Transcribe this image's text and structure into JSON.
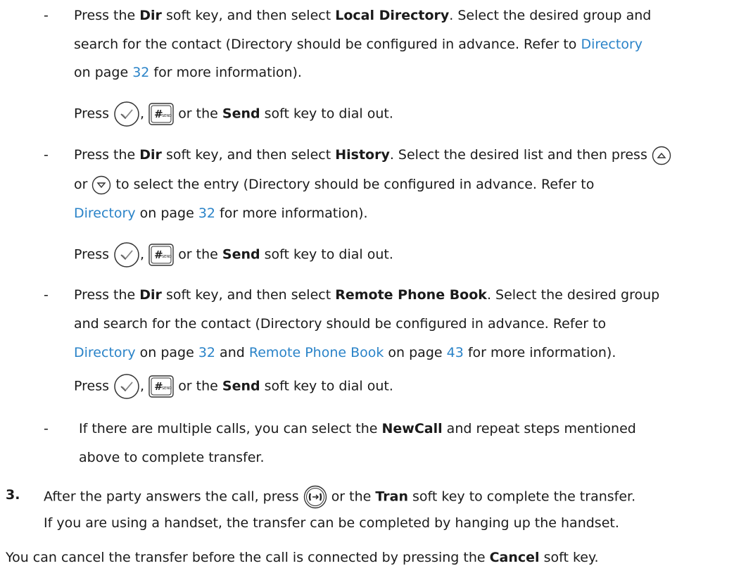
{
  "bullet1": {
    "dash": "-",
    "l1_a": "Press the ",
    "l1_dir": "Dir",
    "l1_b": " soft key, and then select ",
    "l1_target": "Local Directory",
    "l1_c": ". Select the desired group and",
    "l2_a": "search for the contact (Directory should be configured in advance. Refer to ",
    "l2_link": "Directory",
    "l3_a": "on page ",
    "l3_page": "32",
    "l3_b": " for more information).",
    "press": "Press ",
    "comma": ", ",
    "press_tail_a": " or the ",
    "send": "Send",
    "press_tail_b": " soft key to dial out."
  },
  "bullet2": {
    "dash": "-",
    "l1_a": "Press the ",
    "l1_dir": "Dir",
    "l1_b": " soft key, and then select ",
    "l1_target": "History",
    "l1_c": ". Select the desired list and then press ",
    "l2_a": "or ",
    "l2_b": " to select the entry (Directory should be configured in advance. Refer to",
    "l3_link": "Directory",
    "l3_a": " on page ",
    "l3_page": "32",
    "l3_b": " for more information).",
    "press": "Press ",
    "comma": ", ",
    "press_tail_a": " or the ",
    "send": "Send",
    "press_tail_b": " soft key to dial out."
  },
  "bullet3": {
    "dash": "-",
    "l1_a": "Press the ",
    "l1_dir": "Dir",
    "l1_b": " soft key, and then select ",
    "l1_target": "Remote Phone Book",
    "l1_c": ". Select the desired group",
    "l2_a": "and search for the contact (Directory should be configured in advance. Refer to",
    "l3_link1": "Directory",
    "l3_a": " on page ",
    "l3_page1": "32",
    "l3_b": " and ",
    "l3_link2": "Remote Phone Book",
    "l3_c": " on page ",
    "l3_page2": "43",
    "l3_d": " for more information).",
    "press": "Press ",
    "comma": ", ",
    "press_tail_a": " or the ",
    "send": "Send",
    "press_tail_b": " soft key to dial out."
  },
  "bullet4": {
    "dash": "-",
    "l1_a": "If there are multiple calls, you can select the ",
    "l1_b": "NewCall",
    "l1_c": " and repeat steps mentioned",
    "l2": "above to complete transfer."
  },
  "step3": {
    "num": "3.",
    "l1_a": "After the party answers the call, press ",
    "l1_b": " or the ",
    "l1_tran": "Tran",
    "l1_c": " soft key to complete the transfer.",
    "l2": "If you are using a handset, the transfer can be completed by hanging up the handset."
  },
  "footer": {
    "a": "You can cancel the transfer before the call is connected by pressing the ",
    "cancel": "Cancel",
    "b": " soft key."
  },
  "key_labels": {
    "send_key": "#SEND"
  },
  "colors": {
    "link": "#2a83c8",
    "text": "#1a1a1a",
    "key_stroke": "#333333"
  }
}
